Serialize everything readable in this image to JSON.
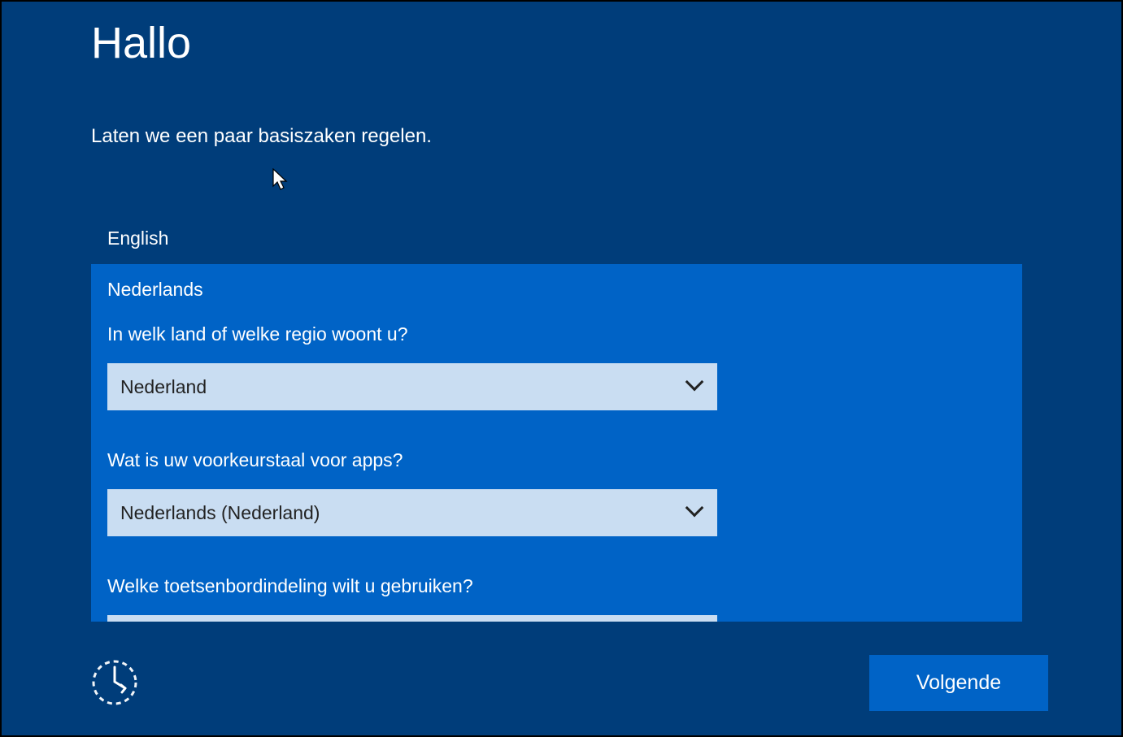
{
  "page": {
    "title": "Hallo",
    "subtitle": "Laten we een paar basiszaken regelen."
  },
  "languages": {
    "inactive": "English",
    "selected": "Nederlands"
  },
  "fields": {
    "country": {
      "label": "In welk land of welke regio woont u?",
      "value": "Nederland"
    },
    "appLanguage": {
      "label": "Wat is uw voorkeurstaal voor apps?",
      "value": "Nederlands (Nederland)"
    },
    "keyboard": {
      "label": "Welke toetsenbordindeling wilt u gebruiken?"
    }
  },
  "footer": {
    "nextButton": "Volgende"
  },
  "colors": {
    "background": "#003d7a",
    "panel": "#0063c6",
    "selectBg": "#c9ddf2",
    "text": "#ffffff"
  }
}
